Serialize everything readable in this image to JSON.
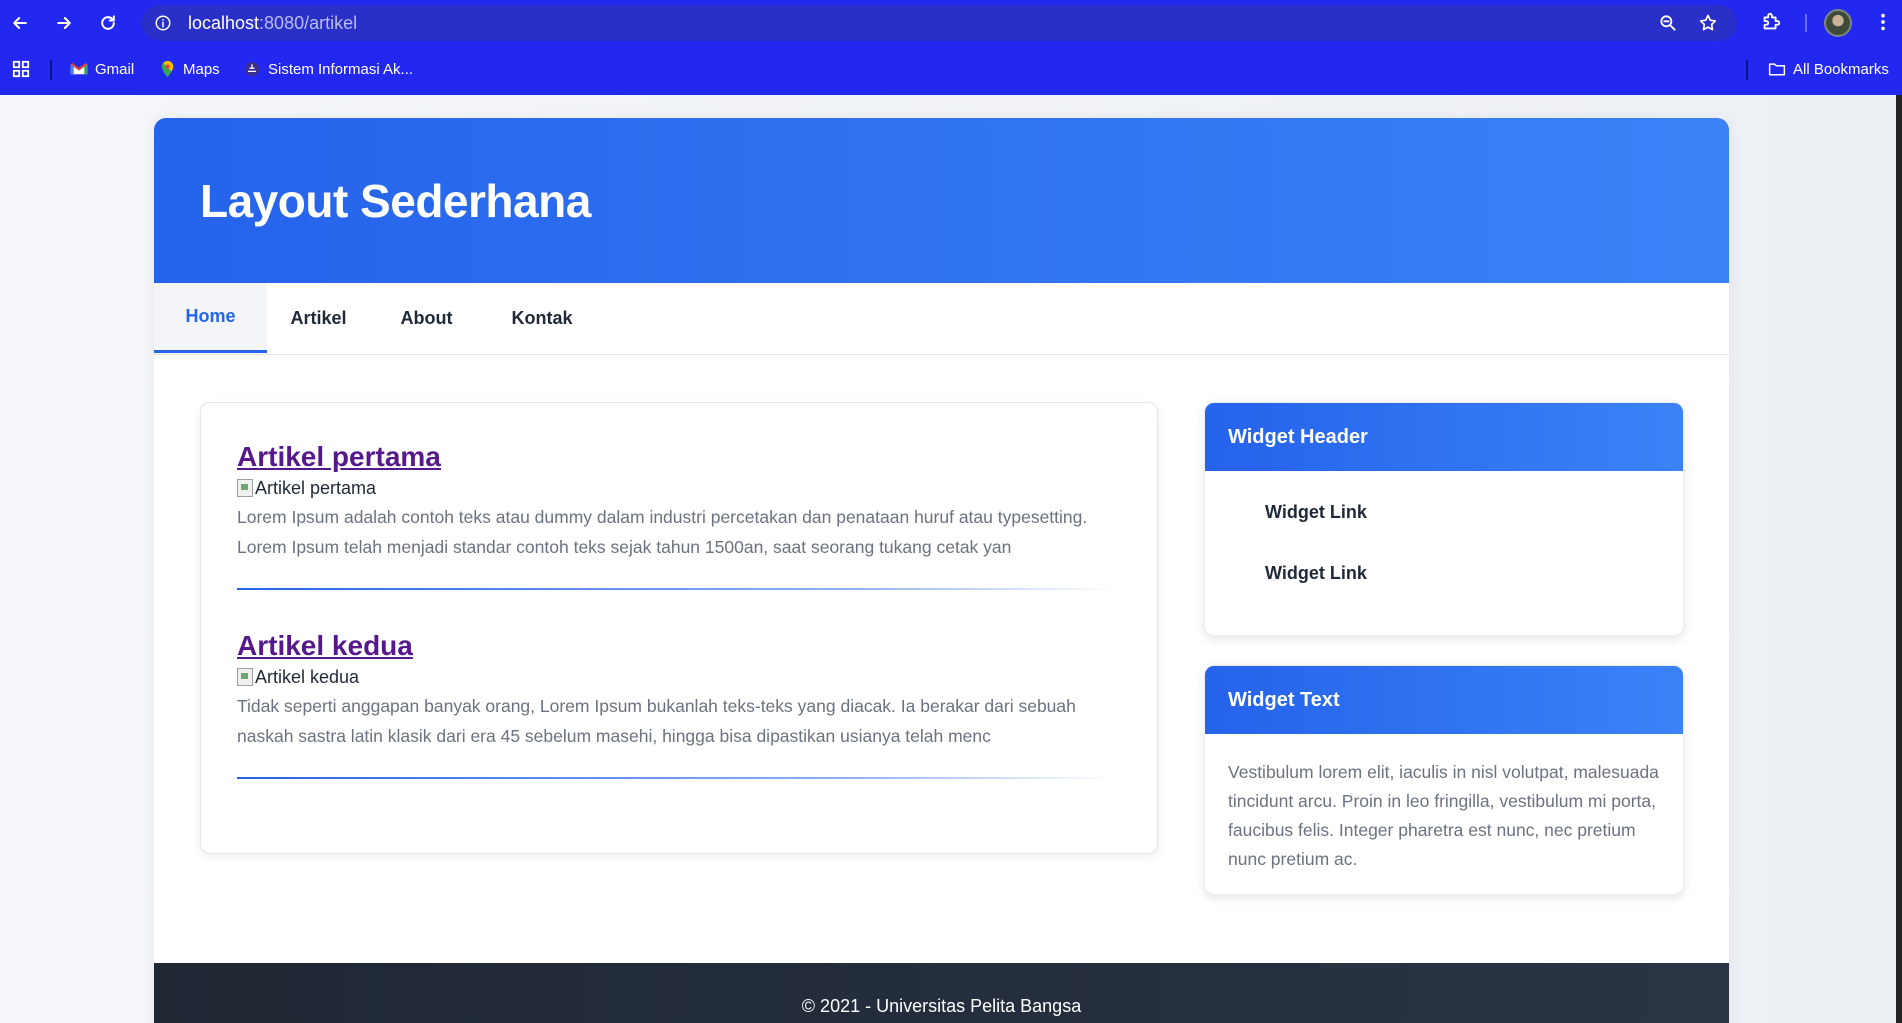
{
  "browser": {
    "url_host": "localhost",
    "url_path": ":8080/artikel",
    "bookmarks": [
      {
        "label": "Gmail",
        "icon": "gmail-icon"
      },
      {
        "label": "Maps",
        "icon": "maps-icon"
      },
      {
        "label": "Sistem Informasi Ak...",
        "icon": "site-icon"
      }
    ],
    "all_bookmarks_label": "All Bookmarks"
  },
  "header": {
    "title": "Layout Sederhana"
  },
  "nav": {
    "items": [
      {
        "label": "Home",
        "active": true
      },
      {
        "label": "Artikel",
        "active": false
      },
      {
        "label": "About",
        "active": false
      },
      {
        "label": "Kontak",
        "active": false
      }
    ]
  },
  "articles": [
    {
      "title": "Artikel pertama",
      "image_alt": "Artikel pertama",
      "text": "Lorem Ipsum adalah contoh teks atau dummy dalam industri percetakan dan penataan huruf atau typesetting. Lorem Ipsum telah menjadi standar contoh teks sejak tahun 1500an, saat seorang tukang cetak yan"
    },
    {
      "title": "Artikel kedua",
      "image_alt": "Artikel kedua",
      "text": "Tidak seperti anggapan banyak orang, Lorem Ipsum bukanlah teks-teks yang diacak. Ia berakar dari sebuah naskah sastra latin klasik dari era 45 sebelum masehi, hingga bisa dipastikan usianya telah menc"
    }
  ],
  "widgets": {
    "links_widget": {
      "header": "Widget Header",
      "links": [
        "Widget Link",
        "Widget Link"
      ]
    },
    "text_widget": {
      "header": "Widget Text",
      "text": "Vestibulum lorem elit, iaculis in nisl volutpat, malesuada tincidunt arcu. Proin in leo fringilla, vestibulum mi porta, faucibus felis. Integer pharetra est nunc, nec pretium nunc pretium ac."
    }
  },
  "footer": {
    "text": "© 2021 - Universitas Pelita Bangsa"
  },
  "colors": {
    "accent": "#2563eb",
    "browser_bar": "#2328f0",
    "footer": "#1f2733",
    "link_visited": "#55198b"
  }
}
